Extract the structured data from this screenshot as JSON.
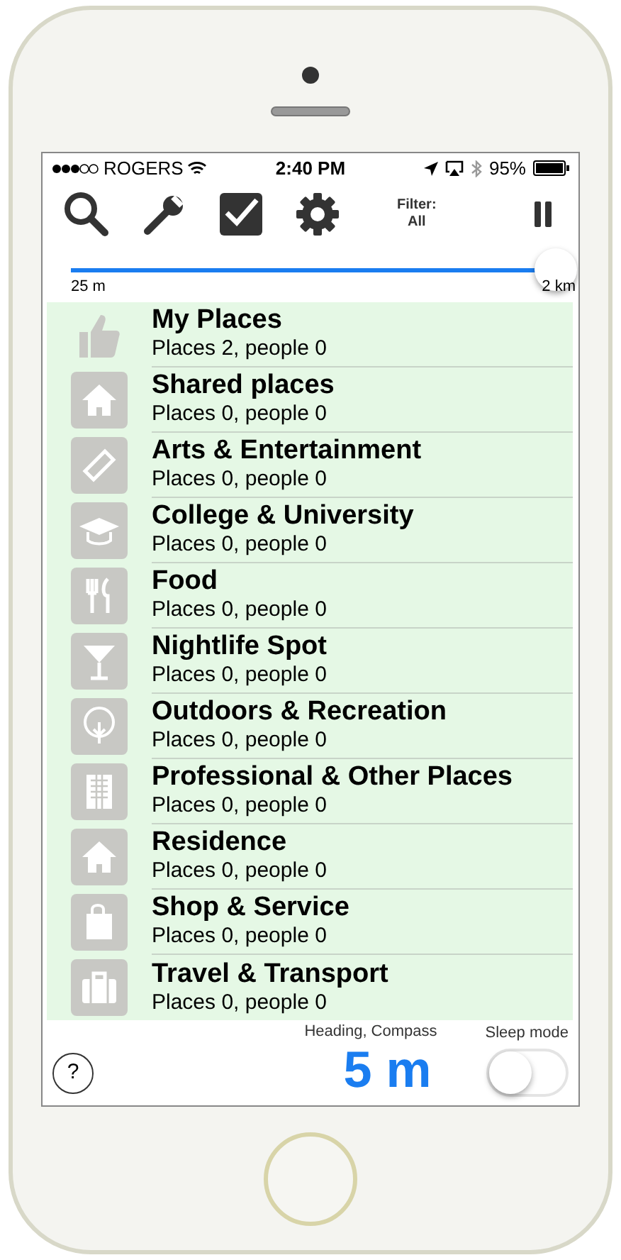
{
  "status_bar": {
    "carrier": "ROGERS",
    "time": "2:40 PM",
    "battery": "95%"
  },
  "toolbar": {
    "filter_label": "Filter:",
    "filter_value": "All"
  },
  "range_slider": {
    "min_label": "25 m",
    "max_label": "2 km",
    "level": 1.0
  },
  "categories": [
    {
      "title": "My Places",
      "subtitle": "Places 2, people 0"
    },
    {
      "title": "Shared places",
      "subtitle": "Places 0, people 0"
    },
    {
      "title": "Arts & Entertainment",
      "subtitle": "Places 0, people 0"
    },
    {
      "title": "College & University",
      "subtitle": "Places 0, people 0"
    },
    {
      "title": "Food",
      "subtitle": "Places 0, people 0"
    },
    {
      "title": "Nightlife Spot",
      "subtitle": "Places 0, people 0"
    },
    {
      "title": "Outdoors & Recreation",
      "subtitle": "Places 0, people 0"
    },
    {
      "title": "Professional & Other Places",
      "subtitle": "Places 0, people 0"
    },
    {
      "title": "Residence",
      "subtitle": "Places 0, people 0"
    },
    {
      "title": "Shop & Service",
      "subtitle": "Places 0, people 0"
    },
    {
      "title": "Travel & Transport",
      "subtitle": "Places 0, people 0"
    }
  ],
  "footer": {
    "help": "?",
    "heading_label": "Heading, Compass",
    "distance": "5 m",
    "sleep_label": "Sleep mode",
    "sleep_mode": {
      "on": false
    }
  }
}
